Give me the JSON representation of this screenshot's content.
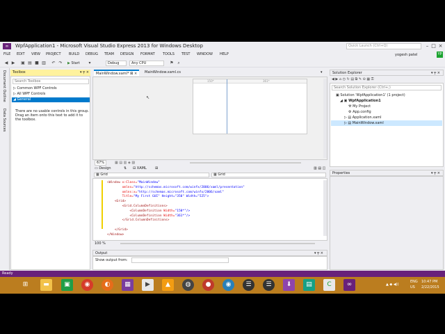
{
  "window": {
    "title": "WpfApplication1 - Microsoft Visual Studio Express 2013 for Windows Desktop",
    "quick_launch_placeholder": "Quick Launch (Ctrl+Q)",
    "user": "yogesh patel",
    "user_badge": "YP"
  },
  "menu": [
    "FILE",
    "EDIT",
    "VIEW",
    "PROJECT",
    "BUILD",
    "DEBUG",
    "TEAM",
    "DESIGN",
    "FORMAT",
    "TOOLS",
    "TEST",
    "WINDOW",
    "HELP"
  ],
  "toolbar": {
    "start_label": "Start",
    "config": "Debug",
    "platform": "Any CPU"
  },
  "left_strip": {
    "document_outline": "Document Outline",
    "data_sources": "Data Sources"
  },
  "toolbox": {
    "title": "Toolbox",
    "search_placeholder": "Search Toolbox",
    "groups": [
      "Common WPF Controls",
      "All WPF Controls",
      "General"
    ],
    "empty_note": "There are no usable controls in this group. Drag an item onto this text to add it to the toolbox."
  },
  "doc_tabs": [
    {
      "label": "MainWindow.xaml*",
      "active": true
    },
    {
      "label": "MainWindow.xaml.cs",
      "active": false
    }
  ],
  "designer": {
    "col1_width": "150*",
    "col2_width": "361*",
    "zoom": "67%",
    "design_tab": "Design",
    "xaml_tab": "XAML"
  },
  "breadcrumbs": {
    "left": "Grid",
    "right": "Grid"
  },
  "code": {
    "lines": [
      {
        "t": "<Window",
        "a": " x:Class=",
        "s": "\"MainWindow\""
      },
      {
        "t": "",
        "a": "        xmlns=",
        "s": "\"http://schemas.microsoft.com/winfx/2006/xaml/presentation\""
      },
      {
        "t": "",
        "a": "        xmlns:x=",
        "s": "\"http://schemas.microsoft.com/winfx/2006/xaml\""
      },
      {
        "t": "",
        "a": "        Title=",
        "s": "\"My First GUI\" Height=\"350\" Width=\"525\">"
      },
      {
        "t": "    <Grid>",
        "a": "",
        "s": ""
      },
      {
        "t": "        <Grid.ColumnDefinitions>",
        "a": "",
        "s": ""
      },
      {
        "t": "            <ColumnDefinition",
        "a": " Width=",
        "s": "\"150*\"/>"
      },
      {
        "t": "            <ColumnDefinition",
        "a": " Width=",
        "s": "\"361*\"/>"
      },
      {
        "t": "        </Grid.ColumnDefinitions>",
        "a": "",
        "s": ""
      },
      {
        "t": "",
        "a": "",
        "s": ""
      },
      {
        "t": "    </Grid>",
        "a": "",
        "s": ""
      },
      {
        "t": "</Window>",
        "a": "",
        "s": ""
      }
    ],
    "zoom": "100 %"
  },
  "output": {
    "title": "Output",
    "show_from_label": "Show output from:"
  },
  "solution_explorer": {
    "title": "Solution Explorer",
    "search_placeholder": "Search Solution Explorer (Ctrl+;)",
    "items": [
      {
        "label": "Solution 'WpfApplication1' (1 project)",
        "indent": 0
      },
      {
        "label": "WpfApplication1",
        "indent": 1
      },
      {
        "label": "My Project",
        "indent": 2
      },
      {
        "label": "App.config",
        "indent": 2
      },
      {
        "label": "Application.xaml",
        "indent": 2
      },
      {
        "label": "MainWindow.xaml",
        "indent": 2
      }
    ]
  },
  "properties": {
    "title": "Properties"
  },
  "status": {
    "text": "Ready"
  },
  "taskbar": {
    "lang": "ENG",
    "region": "US",
    "time": "10:47 PM",
    "date": "2/22/2015"
  },
  "colors": {
    "accent": "#007acc",
    "status_purple": "#68217a",
    "taskbar": "#bb7d1f",
    "active_panel": "#fff29d"
  }
}
